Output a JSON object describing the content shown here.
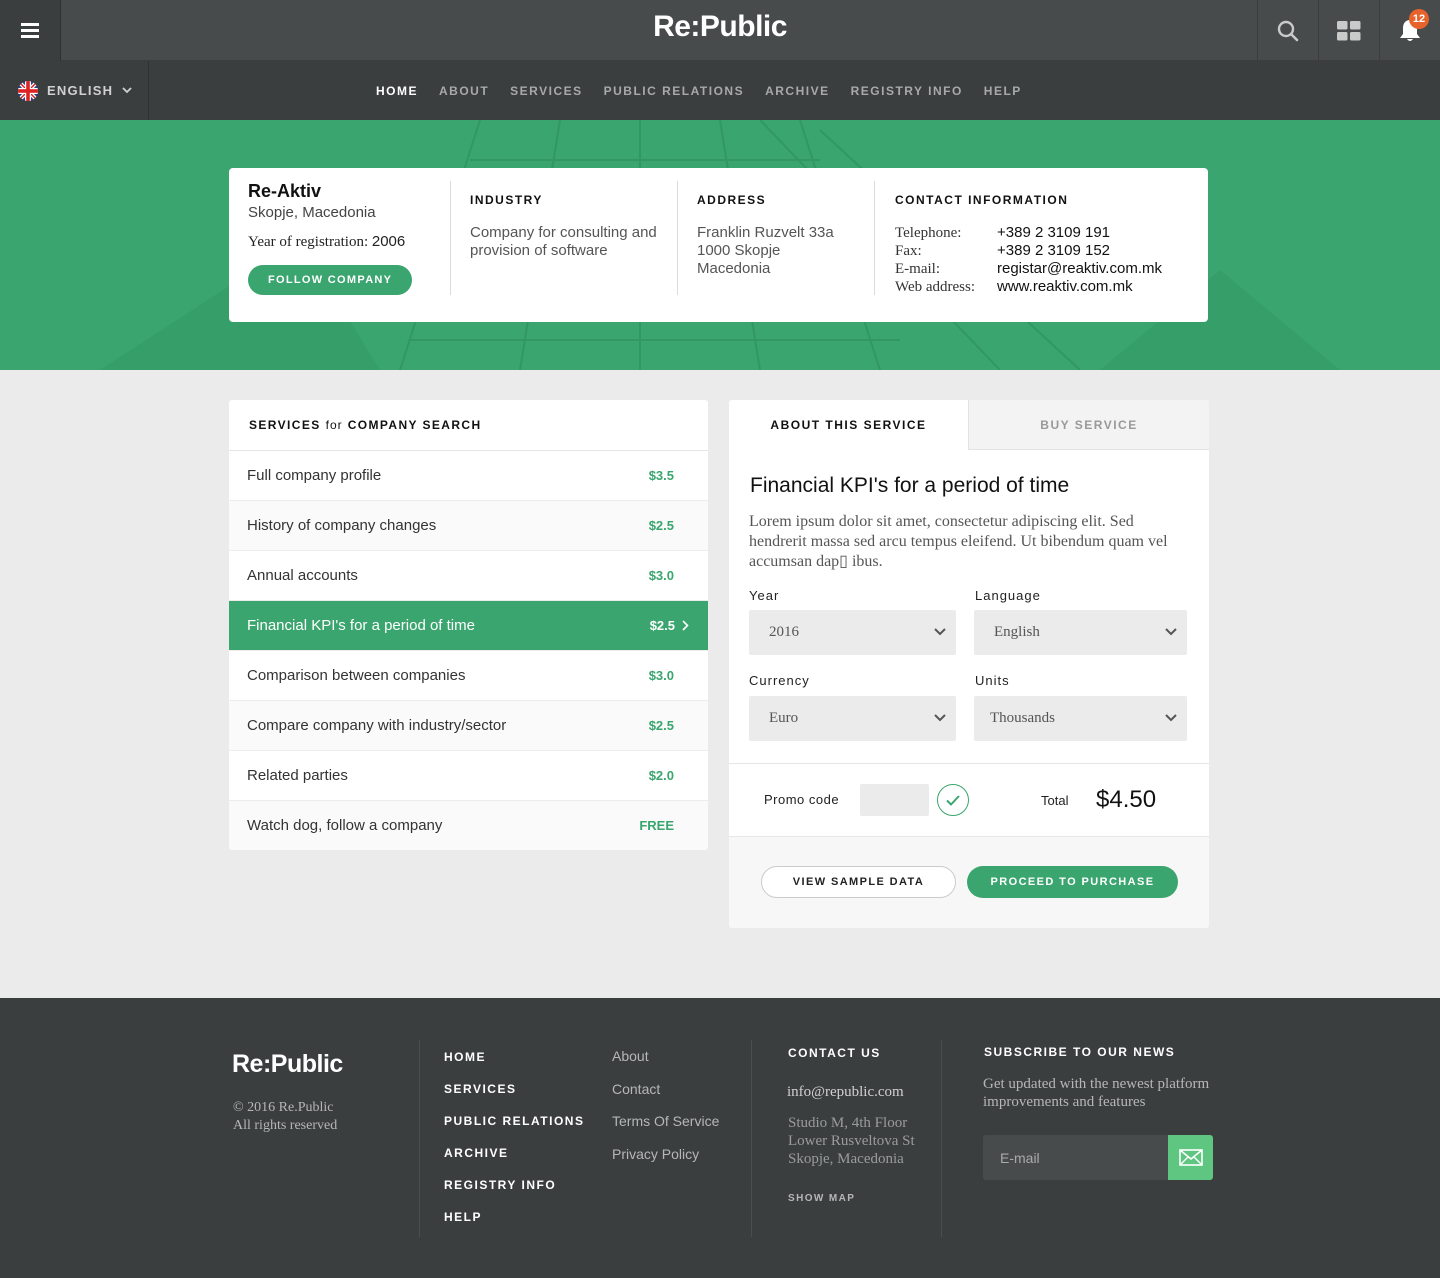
{
  "header": {
    "brand": "Re:Public",
    "notification_count": "12"
  },
  "nav": {
    "language": "ENGLISH",
    "items": [
      "HOME",
      "ABOUT",
      "SERVICES",
      "PUBLIC RELATIONS",
      "ARCHIVE",
      "REGISTRY INFO",
      "HELP"
    ],
    "active": "HOME"
  },
  "company": {
    "name": "Re-Aktiv",
    "city": "Skopje, Macedonia",
    "year_label": "Year of registration:",
    "year_value": "2006",
    "follow_label": "FOLLOW COMPANY",
    "industry_heading": "INDUSTRY",
    "industry_text": "Company for consulting and provision of software",
    "address_heading": "ADDRESS",
    "address_lines": [
      "Franklin Ruzvelt 33a",
      "1000 Skopje",
      "Macedonia"
    ],
    "contact_heading": "CONTACT INFORMATION",
    "contacts": [
      {
        "label": "Telephone:",
        "value": "+389 2 3109 191"
      },
      {
        "label": "Fax:",
        "value": "+389 2 3109 152"
      },
      {
        "label": "E-mail:",
        "value": "registar@reaktiv.com.mk"
      },
      {
        "label": "Web address:",
        "value": "www.reaktiv.com.mk"
      }
    ]
  },
  "services": {
    "heading_a": "SERVICES",
    "heading_for": "for",
    "heading_b": "COMPANY SEARCH",
    "items": [
      {
        "label": "Full company profile",
        "price": "$3.5"
      },
      {
        "label": "History of company changes",
        "price": "$2.5"
      },
      {
        "label": "Annual accounts",
        "price": "$3.0"
      },
      {
        "label": "Financial KPI's for a period of time",
        "price": "$2.5"
      },
      {
        "label": "Comparison between companies",
        "price": "$3.0"
      },
      {
        "label": "Compare company with industry/sector",
        "price": "$2.5"
      },
      {
        "label": "Related parties",
        "price": "$2.0"
      },
      {
        "label": "Watch dog, follow a company",
        "price": "FREE"
      }
    ],
    "active_index": 3
  },
  "panel": {
    "tab_about": "ABOUT THIS SERVICE",
    "tab_buy": "BUY SERVICE",
    "title": "Financial KPI's for a period of time",
    "description": "Lorem ipsum dolor sit amet, consectetur adipiscing elit. Sed hendrerit massa sed arcu tempus eleifend. Ut bibendum quam vel accumsan dap▯ ibus.",
    "year_label": "Year",
    "year_value": "2016",
    "language_label": "Language",
    "language_value": "English",
    "currency_label": "Currency",
    "currency_value": "Euro",
    "units_label": "Units",
    "units_value": "Thousands",
    "promo_label": "Promo code",
    "promo_value": "",
    "total_label": "Total",
    "total_value": "$4.50",
    "sample_label": "VIEW SAMPLE DATA",
    "purchase_label": "PROCEED TO PURCHASE"
  },
  "footer": {
    "brand": "Re:Public",
    "copyright": "© 2016 Re.Public",
    "rights": "All rights reserved",
    "nav": [
      "HOME",
      "SERVICES",
      "PUBLIC RELATIONS",
      "ARCHIVE",
      "REGISTRY INFO",
      "HELP"
    ],
    "links": [
      "About",
      "Contact",
      "Terms Of Service",
      "Privacy Policy"
    ],
    "contact_heading": "CONTACT US",
    "email": "info@republic.com",
    "address_lines": [
      "Studio M, 4th Floor",
      "Lower Rusveltova St",
      "Skopje, Macedonia"
    ],
    "show_map": "SHOW MAP",
    "subscribe_heading": "SUBSCRIBE TO OUR NEWS",
    "subscribe_text": "Get updated with the newest platform improvements and features",
    "email_placeholder": "E-mail"
  },
  "colors": {
    "accent": "#3aa56e",
    "topbar": "#484b4c",
    "navbar": "#3b3e3f",
    "badge": "#e8632b"
  }
}
